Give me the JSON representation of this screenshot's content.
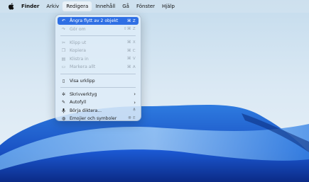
{
  "menubar": {
    "app_name": "Finder",
    "items": [
      "Arkiv",
      "Redigera",
      "Innehåll",
      "Gå",
      "Fönster",
      "Hjälp"
    ],
    "active_item": "Redigera"
  },
  "edit_menu": {
    "group1": [
      {
        "label": "Ångra flytt av 2 objekt",
        "shortcut": "⌘ Z",
        "icon": "undo-icon",
        "state": "highlighted"
      },
      {
        "label": "Gör om",
        "shortcut": "⇧⌘ Z",
        "icon": "redo-icon",
        "state": "disabled"
      }
    ],
    "group2": [
      {
        "label": "Klipp ut",
        "shortcut": "⌘ X",
        "icon": "scissors-icon",
        "state": "disabled"
      },
      {
        "label": "Kopiera",
        "shortcut": "⌘ C",
        "icon": "copy-icon",
        "state": "disabled"
      },
      {
        "label": "Klistra in",
        "shortcut": "⌘ V",
        "icon": "paste-icon",
        "state": "disabled"
      },
      {
        "label": "Markera allt",
        "shortcut": "⌘ A",
        "icon": "select-all-icon",
        "state": "disabled"
      }
    ],
    "group3": [
      {
        "label": "Visa urklipp",
        "icon": "clipboard-icon",
        "state": "enabled"
      }
    ],
    "group4": [
      {
        "label": "Skrivverktyg",
        "icon": "writing-tools-icon",
        "submenu": true,
        "state": "enabled"
      },
      {
        "label": "Autofyll",
        "icon": "autofill-icon",
        "submenu": true,
        "state": "enabled"
      },
      {
        "label": "Börja diktera...",
        "shortcut": "🎙",
        "icon": "microphone-icon",
        "state": "enabled"
      },
      {
        "label": "Emojier och symboler",
        "shortcut": "🌐︎ E",
        "icon": "globe-icon",
        "state": "enabled"
      }
    ]
  },
  "colors": {
    "highlight": "#2f6fe4",
    "disabled_text": "#9aa7b3",
    "wallpaper_blue": "#1f5fd0"
  }
}
